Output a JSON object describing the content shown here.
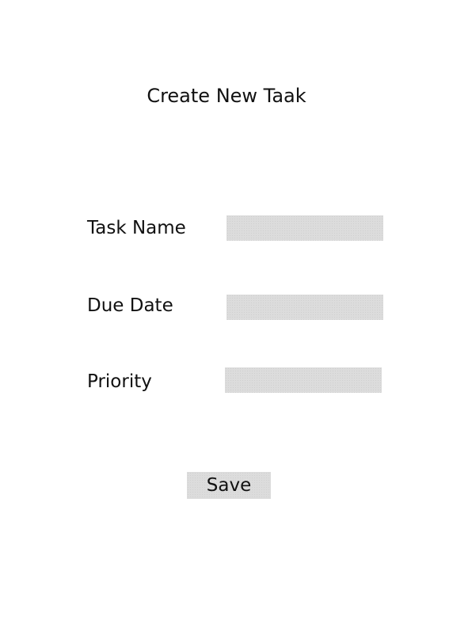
{
  "header": {
    "title": "Create New Taak"
  },
  "form": {
    "fields": [
      {
        "label": "Task Name",
        "value": "",
        "placeholder": ""
      },
      {
        "label": "Due Date",
        "value": "",
        "placeholder": ""
      },
      {
        "label": "Priority",
        "value": "",
        "placeholder": ""
      }
    ],
    "save_label": "Save"
  },
  "colors": {
    "background": "#ffffff",
    "field_fill": "#dcdcdc",
    "button_fill": "#dcdcdc",
    "text": "#111111"
  }
}
